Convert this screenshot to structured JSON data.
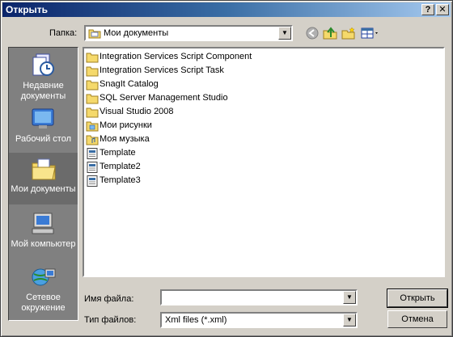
{
  "window": {
    "title": "Открыть",
    "help_glyph": "?",
    "close_glyph": "✕"
  },
  "lookin": {
    "label": "Папка:",
    "value": "Мои документы"
  },
  "places": [
    {
      "label": "Недавние документы",
      "icon": "recent-documents-icon"
    },
    {
      "label": "Рабочий стол",
      "icon": "desktop-icon"
    },
    {
      "label": "Мои документы",
      "icon": "my-documents-icon"
    },
    {
      "label": "Мой компьютер",
      "icon": "my-computer-icon"
    },
    {
      "label": "Сетевое окружение",
      "icon": "network-icon"
    }
  ],
  "files": [
    {
      "name": "Integration Services Script Component",
      "type": "folder"
    },
    {
      "name": "Integration Services Script Task",
      "type": "folder"
    },
    {
      "name": "SnagIt Catalog",
      "type": "folder"
    },
    {
      "name": "SQL Server Management Studio",
      "type": "folder"
    },
    {
      "name": "Visual Studio 2008",
      "type": "folder"
    },
    {
      "name": "Мои рисунки",
      "type": "folder"
    },
    {
      "name": "Моя музыка",
      "type": "folder"
    },
    {
      "name": "Template",
      "type": "xml"
    },
    {
      "name": "Template2",
      "type": "xml"
    },
    {
      "name": "Template3",
      "type": "xml"
    }
  ],
  "filename": {
    "label": "Имя файла:",
    "value": ""
  },
  "filetype": {
    "label": "Тип файлов:",
    "value": "Xml files (*.xml)"
  },
  "buttons": {
    "open": "Открыть",
    "cancel": "Отмена"
  },
  "colors": {
    "title_start": "#0a246a",
    "title_end": "#a6caf0",
    "folder": "#f5d96b",
    "selected_place": "#6b6b6b"
  }
}
